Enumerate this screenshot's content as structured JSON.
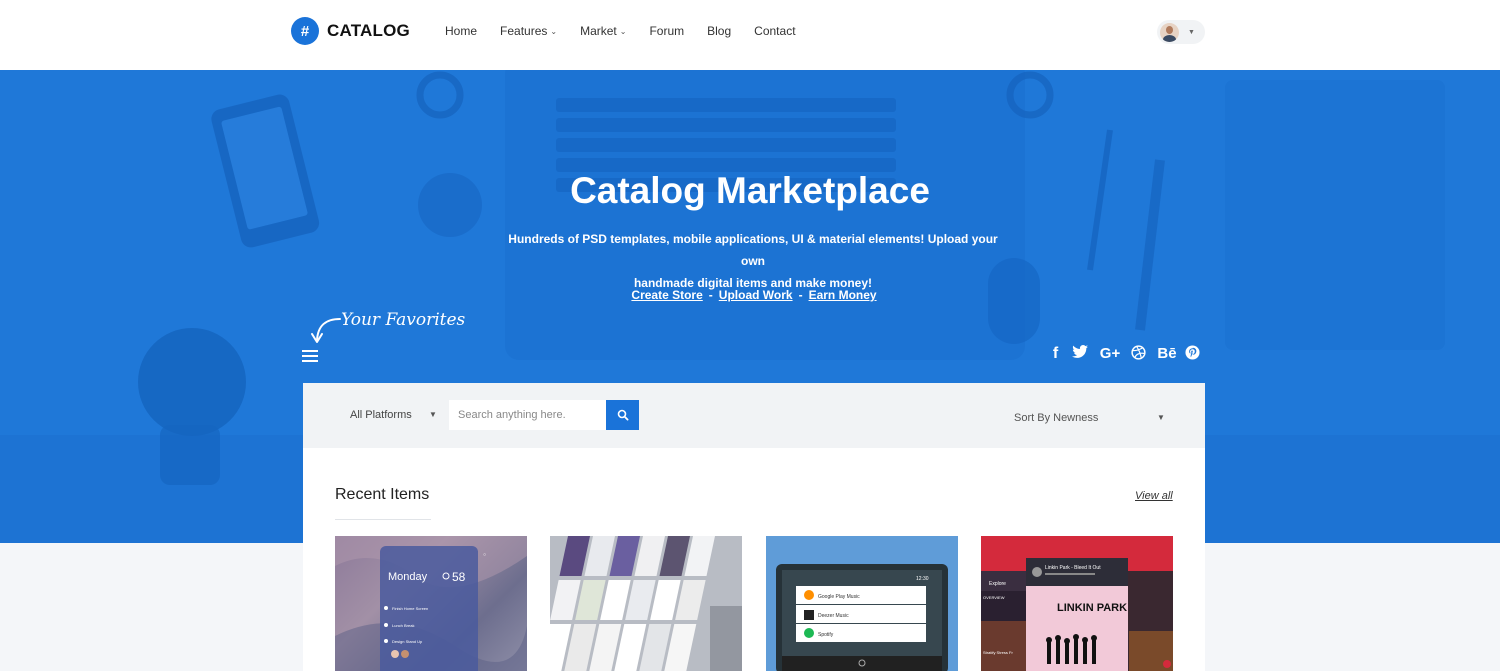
{
  "brand": {
    "logo_glyph": "#",
    "name": "CATALOG",
    "accent": "#1a73d9"
  },
  "nav": {
    "items": [
      {
        "label": "Home",
        "dropdown": false
      },
      {
        "label": "Features",
        "dropdown": true
      },
      {
        "label": "Market",
        "dropdown": true
      },
      {
        "label": "Forum",
        "dropdown": false
      },
      {
        "label": "Blog",
        "dropdown": false
      },
      {
        "label": "Contact",
        "dropdown": false
      }
    ]
  },
  "hero": {
    "title": "Catalog Marketplace",
    "subtitle_line1": "Hundreds of PSD templates, mobile applications, UI & material elements! Upload your own",
    "subtitle_line2": "handmade digital items and make money!",
    "links": [
      "Create Store",
      "Upload Work",
      "Earn Money"
    ],
    "separator": "-",
    "favorites_label": "Your Favorites",
    "background": "#1f78d8",
    "social": [
      "facebook-icon",
      "twitter-icon",
      "google-plus-icon",
      "dribbble-icon",
      "behance-icon",
      "pinterest-icon"
    ]
  },
  "filter": {
    "platform_value": "All Platforms",
    "search_placeholder": "Search anything here.",
    "sort_value": "Sort By Newness"
  },
  "recent": {
    "title": "Recent Items",
    "view_all": "View all",
    "items": [
      {
        "icon": "weather-app-preview",
        "day": "Monday",
        "temp": "58",
        "rows": [
          "Finish Home Screen",
          "Lunch Break",
          "Design Stand Up"
        ]
      },
      {
        "icon": "ui-kit-screens-preview"
      },
      {
        "icon": "android-auto-preview",
        "apps": [
          "Google Play Music",
          "Deezer Music",
          "Spotify"
        ]
      },
      {
        "icon": "music-player-preview",
        "explore": "Explore",
        "track": "Linkin Park - Bleed It Out",
        "album": "LINKIN PARK",
        "overview": "OVERVIEW",
        "foot": "Stratify Stress Fr"
      }
    ]
  }
}
